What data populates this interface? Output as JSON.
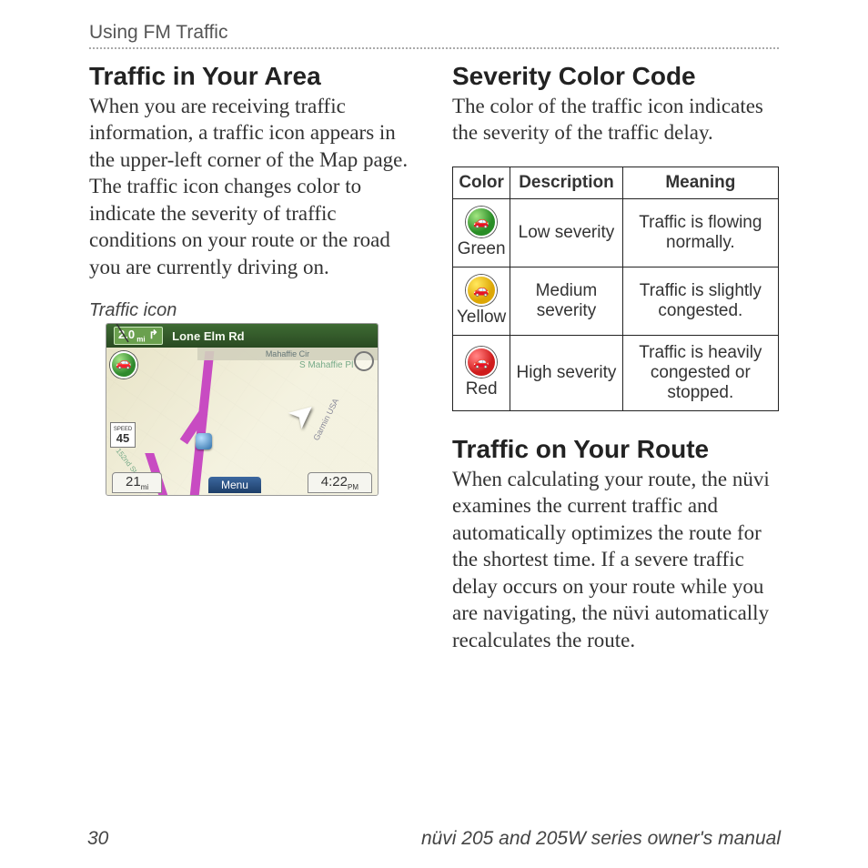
{
  "header": {
    "breadcrumb": "Using FM Traffic"
  },
  "left": {
    "heading": "Traffic in Your Area",
    "para": "When you are receiving traffic information, a traffic icon appears in the upper-left corner of the Map page. The traffic icon changes color to indicate the severity of traffic conditions on your route or the road you are currently driving on.",
    "caption": "Traffic icon",
    "map": {
      "distance": "2.0",
      "arrow_dir": "↱",
      "road_name": "Lone Elm Rd",
      "sub_road": "Mahaffie Cir",
      "cross_road": "S Mahaffie Pl",
      "watermark": "Garmin USA",
      "speed_limit_label": "SPEED",
      "speed_limit_value": "45",
      "tiny_road": "152nd St",
      "left_info": "21",
      "menu_label": "Menu",
      "right_info": "4:22"
    }
  },
  "right": {
    "heading1": "Severity Color Code",
    "para1": "The color of the traffic icon indicates the severity of the traffic delay.",
    "table": {
      "headers": [
        "Color",
        "Description",
        "Meaning"
      ],
      "rows": [
        {
          "color": "Green",
          "desc": "Low severity",
          "mean": "Traffic is flowing normally."
        },
        {
          "color": "Yellow",
          "desc": "Medium severity",
          "mean": "Traffic is slightly congested."
        },
        {
          "color": "Red",
          "desc": "High severity",
          "mean": "Traffic is heavily congested or stopped."
        }
      ]
    },
    "heading2": "Traffic on Your Route",
    "para2": "When calculating your route, the nüvi examines the current traffic and automatically optimizes the route for the shortest time. If a severe traffic delay occurs on your route while you are navigating, the nüvi automatically recalculates the route."
  },
  "footer": {
    "page": "30",
    "title": "nüvi 205 and 205W series owner's manual"
  }
}
